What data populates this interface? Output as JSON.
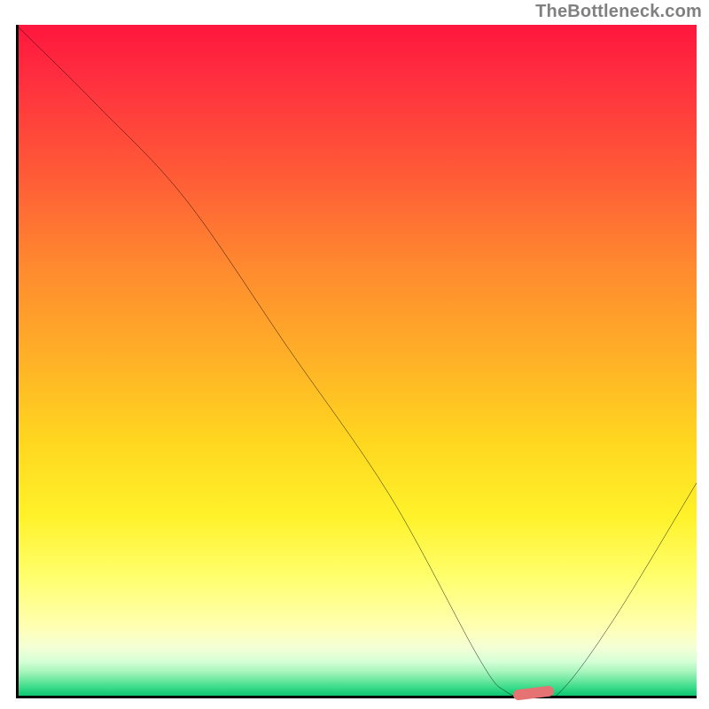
{
  "watermark": "TheBottleneck.com",
  "chart_data": {
    "type": "line",
    "title": "",
    "xlabel": "",
    "ylabel": "",
    "xlim": [
      0,
      100
    ],
    "ylim": [
      0,
      100
    ],
    "grid": false,
    "legend": false,
    "background": {
      "type": "vertical_gradient",
      "stops": [
        {
          "pos": 0,
          "color": "#ff163d"
        },
        {
          "pos": 22,
          "color": "#ff5a37"
        },
        {
          "pos": 50,
          "color": "#ffb227"
        },
        {
          "pos": 73,
          "color": "#fff22a"
        },
        {
          "pos": 90,
          "color": "#ffffb4"
        },
        {
          "pos": 100,
          "color": "#08c36e"
        }
      ]
    },
    "series": [
      {
        "name": "bottleneck-curve",
        "color": "#000000",
        "x": [
          0,
          12,
          25,
          40,
          55,
          68,
          72,
          76,
          80,
          88,
          100
        ],
        "y": [
          100,
          88,
          74,
          52,
          30,
          6,
          1,
          0,
          1,
          12,
          32
        ]
      }
    ],
    "annotations": [
      {
        "name": "optimal-marker",
        "shape": "rounded-bar",
        "color": "#e57373",
        "x": 76,
        "y": 0.8,
        "rotation_deg": -7
      }
    ]
  }
}
